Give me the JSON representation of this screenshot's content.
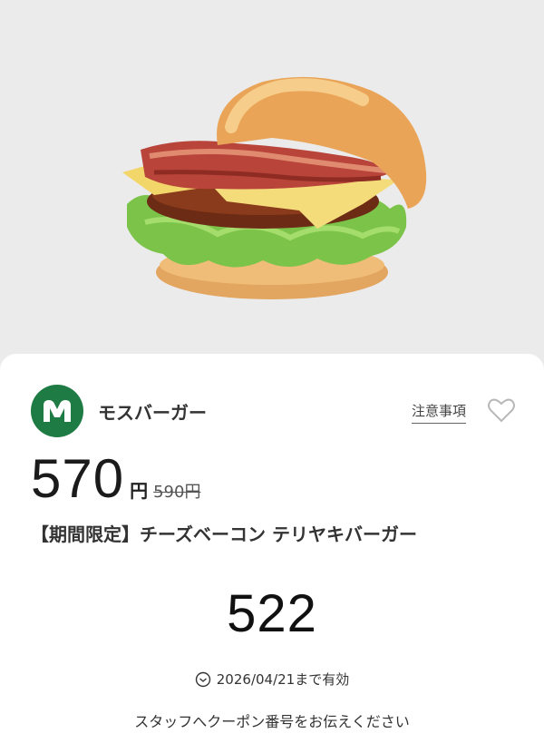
{
  "brand": {
    "name": "モスバーガー",
    "logo_icon": "mos-logo-icon",
    "logo_color": "#1e7b43"
  },
  "links": {
    "notes": "注意事項"
  },
  "favorite": {
    "icon": "heart-outline-icon"
  },
  "product": {
    "price": "570",
    "price_unit": "円",
    "original_price": "590円",
    "name": "【期間限定】チーズベーコン テリヤキバーガー",
    "image": "burger-photo"
  },
  "coupon": {
    "code": "522",
    "expiry": "2026/04/21まで有効",
    "instruction": "スタッフへクーポン番号をお伝えください"
  }
}
